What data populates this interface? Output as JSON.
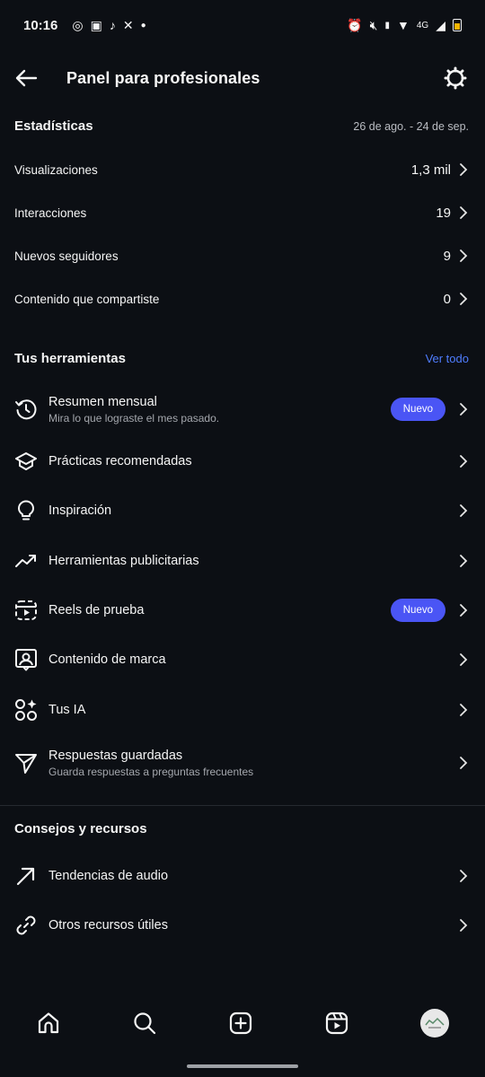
{
  "status_bar": {
    "time": "10:16",
    "network": "4G"
  },
  "header": {
    "title": "Panel para profesionales"
  },
  "stats": {
    "title": "Estadísticas",
    "date_range": "26 de ago. - 24 de sep.",
    "rows": [
      {
        "label": "Visualizaciones",
        "value": "1,3 mil"
      },
      {
        "label": "Interacciones",
        "value": "19"
      },
      {
        "label": "Nuevos seguidores",
        "value": "9"
      },
      {
        "label": "Contenido que compartiste",
        "value": "0"
      }
    ]
  },
  "tools": {
    "title": "Tus herramientas",
    "see_all": "Ver todo",
    "items": [
      {
        "label": "Resumen mensual",
        "sub": "Mira lo que lograste el mes pasado.",
        "badge": "Nuevo",
        "icon": "history-icon"
      },
      {
        "label": "Prácticas recomendadas",
        "icon": "graduation-cap-icon"
      },
      {
        "label": "Inspiración",
        "icon": "lightbulb-icon"
      },
      {
        "label": "Herramientas publicitarias",
        "icon": "trending-up-icon"
      },
      {
        "label": "Reels de prueba",
        "badge": "Nuevo",
        "icon": "reels-test-icon"
      },
      {
        "label": "Contenido de marca",
        "icon": "branded-content-icon"
      },
      {
        "label": "Tus IA",
        "icon": "ai-icon"
      },
      {
        "label": "Respuestas guardadas",
        "sub": "Guarda respuestas a preguntas frecuentes",
        "icon": "send-icon"
      }
    ]
  },
  "resources": {
    "title": "Consejos y recursos",
    "items": [
      {
        "label": "Tendencias de audio",
        "icon": "arrow-up-right-icon"
      },
      {
        "label": "Otros recursos útiles",
        "icon": "link-icon"
      }
    ]
  },
  "colors": {
    "background": "#0c0f14",
    "accent": "#4f7dff",
    "badge": "#4a55f5"
  }
}
